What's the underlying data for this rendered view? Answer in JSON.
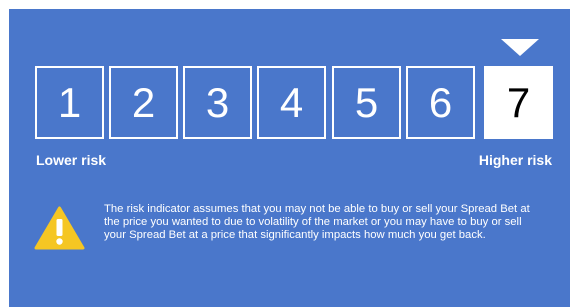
{
  "risk_indicator": {
    "levels": [
      "1",
      "2",
      "3",
      "4",
      "5",
      "6",
      "7"
    ],
    "selected_level": 7,
    "low_label": "Lower risk",
    "high_label": "Higher risk",
    "note": "The risk indicator assumes that you may not be able to buy or sell your Spread Bet at the price you wanted to  due to volatility of the market or you may have to buy or sell your Spread Bet at a price that significantly impacts how much you get back."
  },
  "colors": {
    "panel_background": "#4a77cb",
    "warning_triangle": "#f5c623",
    "selected_box": "#ffffff"
  },
  "icons": {
    "marker": "triangle-down-icon",
    "warning": "warning-icon"
  }
}
